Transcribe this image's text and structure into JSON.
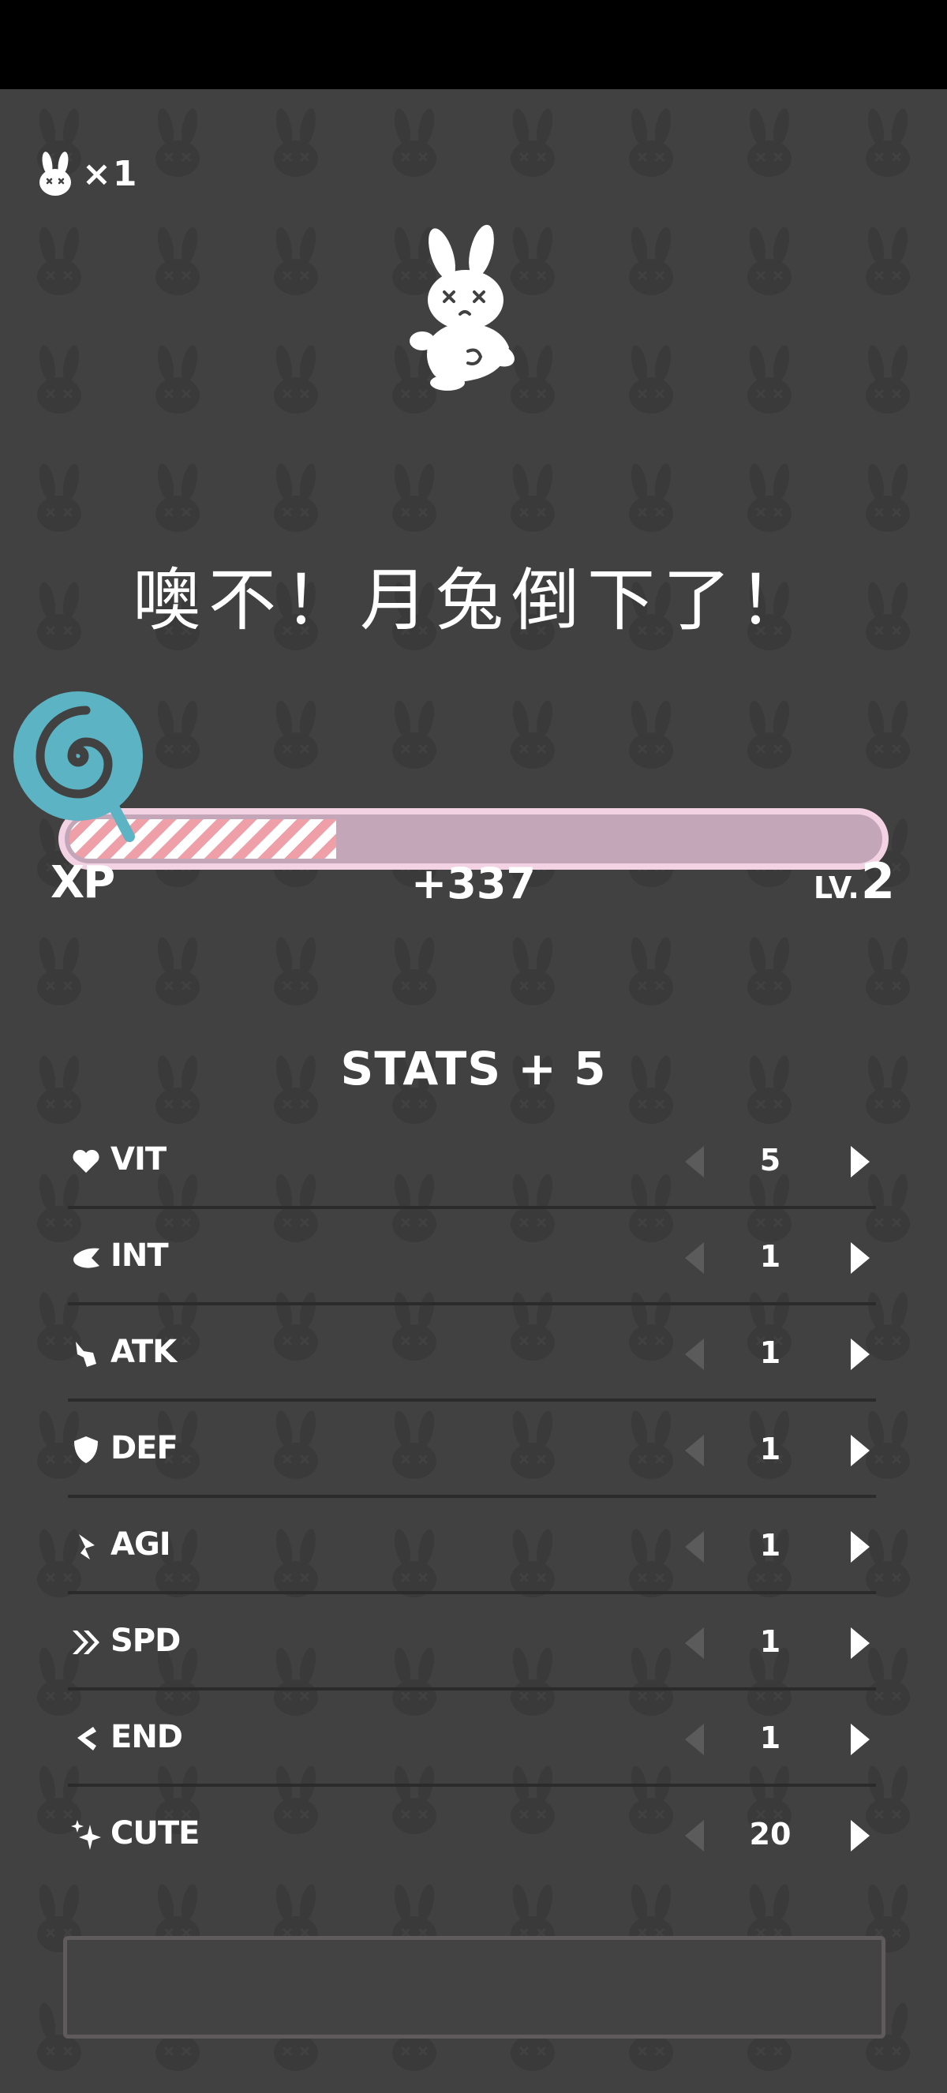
{
  "lives": {
    "icon": "bunny-head-icon",
    "count_text": "×1"
  },
  "character": {
    "icon": "fallen-bunny-icon"
  },
  "gameover": {
    "title": "噢不！月兔倒下了！"
  },
  "xp": {
    "label": "XP",
    "gain": "+337",
    "progress": 0.33,
    "level_prefix": "LV.",
    "level_value": "2",
    "icon": "lollipop-icon"
  },
  "stats": {
    "title": "STATS + 5",
    "items": [
      {
        "icon": "heart-icon",
        "name": "VIT",
        "value": "5"
      },
      {
        "icon": "brain-icon",
        "name": "INT",
        "value": "1"
      },
      {
        "icon": "claw-icon",
        "name": "ATK",
        "value": "1"
      },
      {
        "icon": "shield-icon",
        "name": "DEF",
        "value": "1"
      },
      {
        "icon": "dash-icon",
        "name": "AGI",
        "value": "1"
      },
      {
        "icon": "double-chevron-icon",
        "name": "SPD",
        "value": "1"
      },
      {
        "icon": "boot-icon",
        "name": "END",
        "value": "1"
      },
      {
        "icon": "sparkle-icon",
        "name": "CUTE",
        "value": "20"
      }
    ]
  },
  "colors": {
    "background": "#414141",
    "bar_border": "#f3d2e4",
    "bar_track": "#c4a6b9",
    "bar_stripe": "#ef9fa8",
    "lollipop": "#5bb3c4"
  }
}
